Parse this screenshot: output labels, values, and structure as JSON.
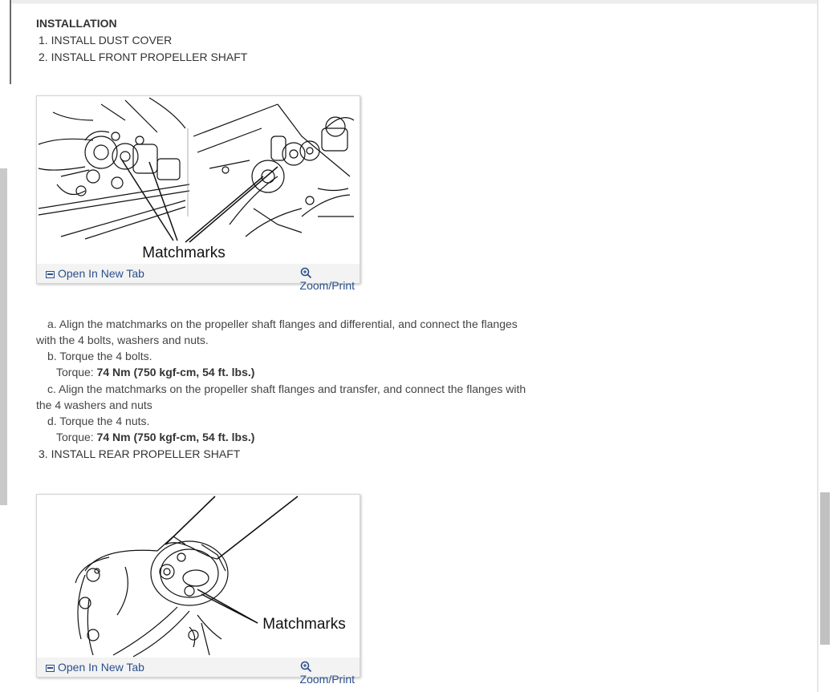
{
  "section": {
    "heading": "INSTALLATION",
    "step1": "1. INSTALL DUST COVER",
    "step2": "2. INSTALL FRONT PROPELLER SHAFT",
    "step3": "3. INSTALL REAR PROPELLER SHAFT"
  },
  "figure1": {
    "label": "Matchmarks",
    "open_label": "Open In New Tab",
    "zoom_label": "Zoom/Print",
    "open_icon": "open-tab-icon",
    "zoom_icon": "zoom-icon"
  },
  "figure2": {
    "label": "Matchmarks",
    "open_label": "Open In New Tab",
    "zoom_label": "Zoom/Print",
    "open_icon": "open-tab-icon",
    "zoom_icon": "zoom-icon"
  },
  "substeps": {
    "a_line1": "a. Align the matchmarks on the propeller shaft flanges and differential, and connect the flanges",
    "a_line2": "with the 4 bolts, washers and nuts.",
    "b": "b. Torque the 4 bolts.",
    "b_torque_label": "Torque: ",
    "b_torque_value": "74 Nm (750 kgf-cm, 54 ft. lbs.)",
    "c_line1": "c. Align the matchmarks on the propeller shaft flanges and transfer, and connect the flanges with",
    "c_line2": "the 4 washers and nuts",
    "d": "d. Torque the 4 nuts.",
    "d_torque_label": "Torque: ",
    "d_torque_value": "74 Nm (750 kgf-cm, 54 ft. lbs.)"
  },
  "colors": {
    "link": "#2a4f8c",
    "text": "#333333"
  }
}
